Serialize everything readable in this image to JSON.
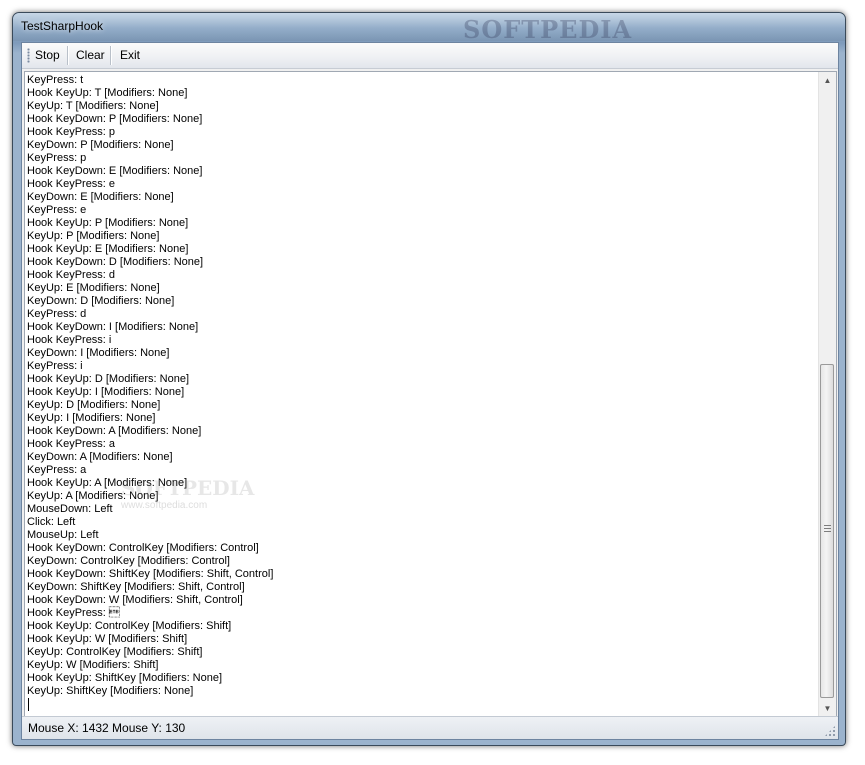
{
  "window": {
    "title": "TestSharpHook",
    "watermark": "SOFTPEDIA"
  },
  "menu": {
    "stop_label": "Stop",
    "clear_label": "Clear",
    "exit_label": "Exit"
  },
  "log": {
    "lines": [
      "KeyPress: t",
      "Hook KeyUp: T [Modifiers: None]",
      "KeyUp: T [Modifiers: None]",
      "Hook KeyDown: P [Modifiers: None]",
      "Hook KeyPress: p",
      "KeyDown: P [Modifiers: None]",
      "KeyPress: p",
      "Hook KeyDown: E [Modifiers: None]",
      "Hook KeyPress: e",
      "KeyDown: E [Modifiers: None]",
      "KeyPress: e",
      "Hook KeyUp: P [Modifiers: None]",
      "KeyUp: P [Modifiers: None]",
      "Hook KeyUp: E [Modifiers: None]",
      "Hook KeyDown: D [Modifiers: None]",
      "Hook KeyPress: d",
      "KeyUp: E [Modifiers: None]",
      "KeyDown: D [Modifiers: None]",
      "KeyPress: d",
      "Hook KeyDown: I [Modifiers: None]",
      "Hook KeyPress: i",
      "KeyDown: I [Modifiers: None]",
      "KeyPress: i",
      "Hook KeyUp: D [Modifiers: None]",
      "Hook KeyUp: I [Modifiers: None]",
      "KeyUp: D [Modifiers: None]",
      "KeyUp: I [Modifiers: None]",
      "Hook KeyDown: A [Modifiers: None]",
      "Hook KeyPress: a",
      "KeyDown: A [Modifiers: None]",
      "KeyPress: a",
      "Hook KeyUp: A [Modifiers: None]",
      "KeyUp: A [Modifiers: None]",
      "MouseDown: Left",
      "Click: Left",
      "MouseUp: Left",
      "Hook KeyDown: ControlKey [Modifiers: Control]",
      "KeyDown: ControlKey [Modifiers: Control]",
      "Hook KeyDown: ShiftKey [Modifiers: Shift, Control]",
      "KeyDown: ShiftKey [Modifiers: Shift, Control]",
      "Hook KeyDown: W [Modifiers: Shift, Control]",
      "Hook KeyPress: \u0017",
      "Hook KeyUp: ControlKey [Modifiers: Shift]",
      "Hook KeyUp: W [Modifiers: Shift]",
      "KeyUp: ControlKey [Modifiers: Shift]",
      "KeyUp: W [Modifiers: Shift]",
      "Hook KeyUp: ShiftKey [Modifiers: None]",
      "KeyUp: ShiftKey [Modifiers: None]"
    ],
    "watermark": "SOFTPEDIA",
    "watermark_url": "www.softpedia.com"
  },
  "status": {
    "text": "Mouse X: 1432 Mouse Y: 130"
  },
  "scrollbar": {
    "position_fraction": 1.0
  }
}
